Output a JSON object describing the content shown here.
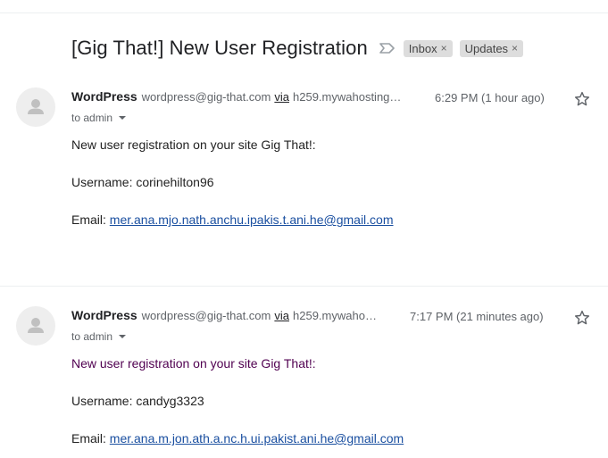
{
  "subject": {
    "title": "[Gig That!] New User Registration",
    "labels": [
      {
        "name": "Inbox",
        "remove": "×"
      },
      {
        "name": "Updates",
        "remove": "×"
      }
    ]
  },
  "messages": [
    {
      "sender_name": "WordPress",
      "sender_email": "wordpress@gig-that.com",
      "via_label": "via",
      "via_host": "h259.mywahosting…",
      "timestamp": "6:29 PM (1 hour ago)",
      "to": "to admin",
      "body": {
        "intro": "New user registration on your site Gig That!:",
        "username_line": "Username: corinehilton96",
        "email_prefix": "Email: ",
        "email_link": "mer.ana.mjo.nath.anchu.ipakis.t.ani.he@gmail.com"
      }
    },
    {
      "sender_name": "WordPress",
      "sender_email": "wordpress@gig-that.com",
      "via_label": "via",
      "via_host": "h259.mywaho…",
      "timestamp": "7:17 PM (21 minutes ago)",
      "to": "to admin",
      "body": {
        "intro": "New user registration on your site Gig That!:",
        "username_line": "Username: candyg3323",
        "email_prefix": "Email: ",
        "email_link": "mer.ana.m.jon.ath.a.nc.h.ui.pakist.ani.he@gmail.com"
      }
    }
  ],
  "icons": {
    "important": "important-marker-icon",
    "avatar": "default-avatar-icon",
    "star": "star-outline-icon",
    "caret": "caret-down-icon"
  },
  "colors": {
    "chip_bg": "#dddddd",
    "link": "#1a4fa0",
    "visited_text": "#500050",
    "muted": "#5f6368"
  }
}
